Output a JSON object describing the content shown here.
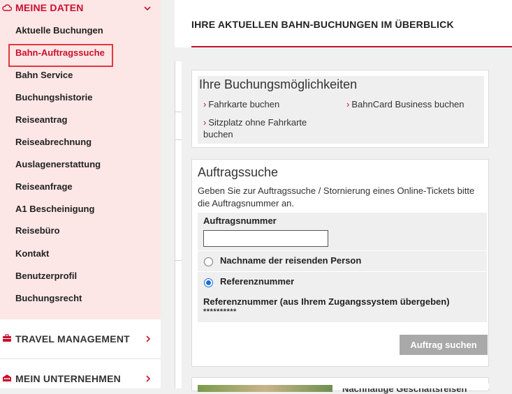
{
  "sidebar": {
    "meine_daten": {
      "title": "MEINE DATEN",
      "icon": "cloud-icon"
    },
    "items": [
      {
        "label": "Aktuelle Buchungen",
        "active": false
      },
      {
        "label": "Bahn-Auftragssuche",
        "active": true
      },
      {
        "label": "Bahn Service",
        "active": false
      },
      {
        "label": "Buchungshistorie",
        "active": false
      },
      {
        "label": "Reiseantrag",
        "active": false
      },
      {
        "label": "Reiseabrechnung",
        "active": false
      },
      {
        "label": "Auslagenerstattung",
        "active": false
      },
      {
        "label": "Reiseanfrage",
        "active": false
      },
      {
        "label": "A1 Bescheinigung",
        "active": false
      },
      {
        "label": "Reisebüro",
        "active": false
      },
      {
        "label": "Kontakt",
        "active": false
      },
      {
        "label": "Benutzerprofil",
        "active": false
      },
      {
        "label": "Buchungsrecht",
        "active": false
      }
    ],
    "travel_management": {
      "title": "TRAVEL MANAGEMENT",
      "icon": "briefcase-icon"
    },
    "mein_unternehmen": {
      "title": "MEIN UNTERNEHMEN",
      "icon": "building-icon"
    }
  },
  "header": {
    "title": "IHRE AKTUELLEN BAHN-BUCHUNGEN IM ÜBERBLICK"
  },
  "buchungsmoeglichkeiten": {
    "title": "Ihre Buchungsmöglichkeiten",
    "options": [
      "Fahrkarte buchen",
      "BahnCard Business buchen",
      "Sitzplatz ohne Fahrkarte buchen"
    ]
  },
  "auftragssuche": {
    "title": "Auftragssuche",
    "description": "Geben Sie zur Auftragssuche / Stornierung eines Online-Tickets bitte die Auftragsnummer an.",
    "auftragsnummer_label": "Auftragsnummer",
    "auftragsnummer_value": "",
    "radio_nachname": "Nachname der reisenden Person",
    "radio_referenz": "Referenznummer",
    "selected": "Referenznummer",
    "referenz_label": "Referenznummer (aus Ihrem Zugangssystem übergeben)",
    "referenz_value": "**********",
    "submit": "Auftrag suchen"
  },
  "teaser": {
    "text": "Nachhaltige Geschäftsreisen"
  },
  "colors": {
    "accent": "#c8102e",
    "sidebar_bg": "#fde6e6",
    "button_disabled": "#a9a9a9",
    "radio": "#1a6dd8"
  }
}
